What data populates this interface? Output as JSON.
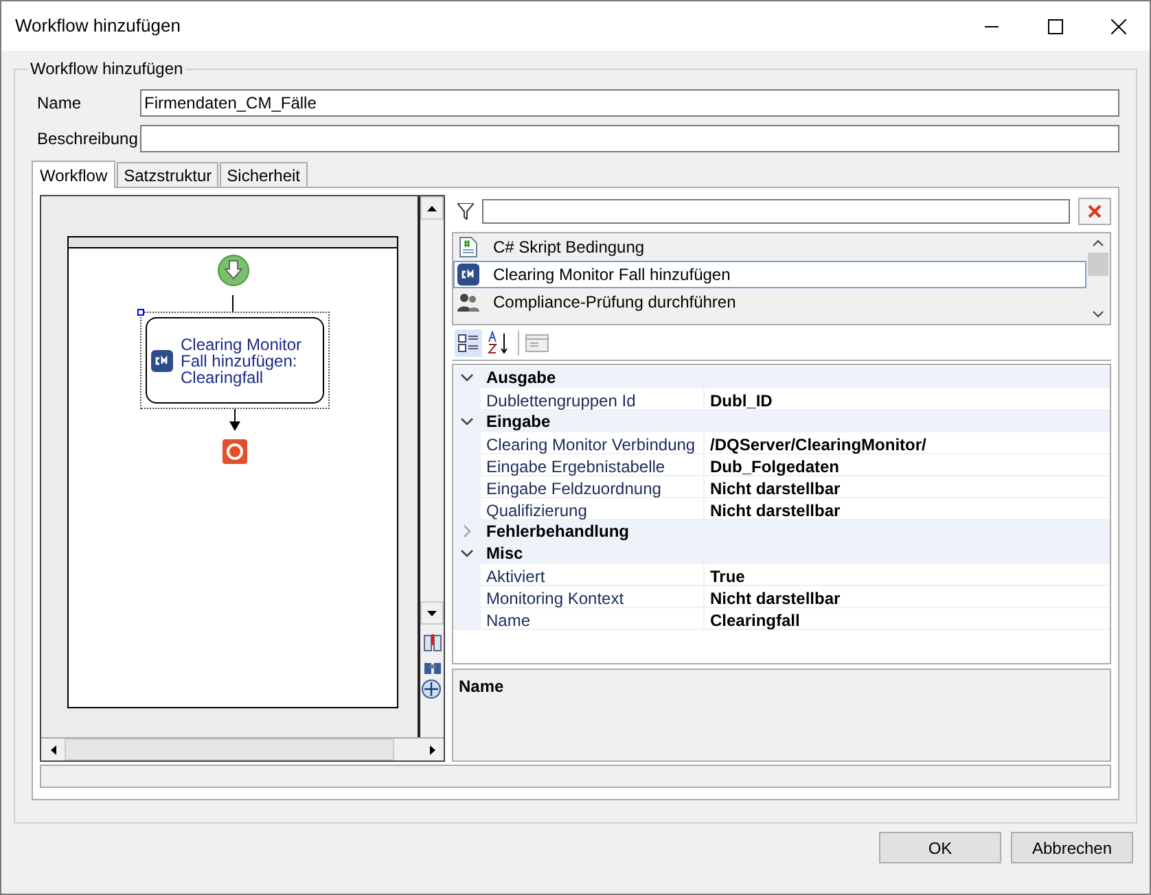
{
  "window": {
    "title": "Workflow hinzufügen"
  },
  "group": {
    "title": "Workflow hinzufügen"
  },
  "fields": [
    {
      "label": "Name",
      "value": "Firmendaten_CM_Fälle"
    },
    {
      "label": "Beschreibung"
    }
  ],
  "tabs": [
    {
      "label": "Workflow",
      "selected": true
    },
    {
      "label": "Satzstruktur",
      "selected": false
    },
    {
      "label": "Sicherheit",
      "selected": false
    }
  ],
  "designer": {
    "node": {
      "lines": [
        "Clearing Monitor",
        "Fall hinzufügen:",
        "Clearingfall"
      ],
      "selected": true
    }
  },
  "toolbox": {
    "items": [
      {
        "label": "C# Skript Bedingung",
        "kind": "script",
        "selected": false
      },
      {
        "label": "Clearing Monitor Fall hinzufügen",
        "kind": "cm",
        "selected": true
      },
      {
        "label": "Compliance-Prüfung durchführen",
        "kind": "people",
        "selected": false
      }
    ]
  },
  "properties": {
    "categories": [
      {
        "name": "Ausgabe",
        "expanded": true,
        "rows": [
          {
            "name": "Dublettengruppen Id",
            "value": "Dubl_ID"
          }
        ]
      },
      {
        "name": "Eingabe",
        "expanded": true,
        "rows": [
          {
            "name": "Clearing Monitor Verbindung",
            "value": "/DQServer/ClearingMonitor/"
          },
          {
            "name": "Eingabe Ergebnistabelle",
            "value": "Dub_Folgedaten"
          },
          {
            "name": "Eingabe Feldzuordnung",
            "value": "Nicht darstellbar"
          },
          {
            "name": "Qualifizierung",
            "value": "Nicht darstellbar"
          }
        ]
      },
      {
        "name": "Fehlerbehandlung",
        "expanded": false
      },
      {
        "name": "Misc",
        "expanded": true,
        "rows": [
          {
            "name": "Aktiviert",
            "value": "True"
          },
          {
            "name": "Monitoring Kontext",
            "value": "Nicht darstellbar"
          },
          {
            "name": "Name",
            "value": "Clearingfall"
          }
        ]
      }
    ]
  },
  "description": {
    "title": "Name"
  },
  "buttons": [
    "OK",
    "Abbrechen"
  ]
}
